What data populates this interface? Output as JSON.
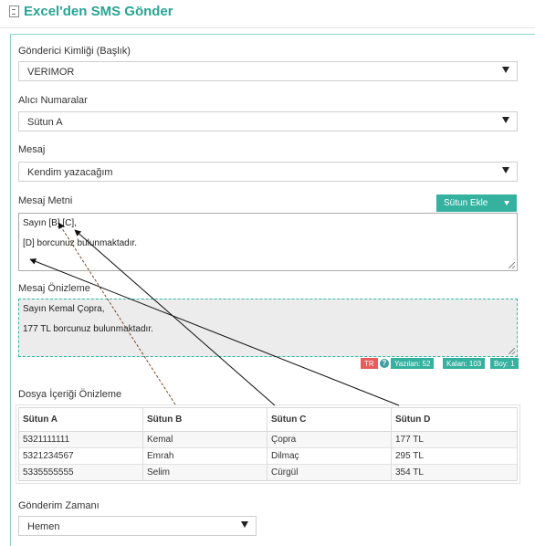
{
  "header": {
    "title": "Excel'den SMS Gönder",
    "icon": "excel-file-icon"
  },
  "sender": {
    "label": "Gönderici Kimliği (Başlık)",
    "value": "VERIMOR"
  },
  "recipients": {
    "label": "Alıcı Numaralar",
    "value": "Sütun A"
  },
  "message": {
    "label": "Mesaj",
    "value": "Kendim yazacağım"
  },
  "message_text": {
    "label": "Mesaj Metni",
    "column_button": "Sütun Ekle",
    "line1": "Sayın [B] [C],",
    "line2": "",
    "line3": "[D] borcunuz bulunmaktadır."
  },
  "message_preview": {
    "label": "Mesaj Önizleme",
    "line1": "Sayın Kemal Çopra,",
    "line2": "",
    "line3": "177 TL borcunuz bulunmaktadır."
  },
  "stats": {
    "lang": "TR",
    "help": "?",
    "written": "Yazılan: 52",
    "remaining": "Kalan: 103",
    "size": "Boy: 1"
  },
  "file_preview": {
    "label": "Dosya İçeriği Önizleme",
    "columns": [
      "Sütun A",
      "Sütun B",
      "Sütun C",
      "Sütun D"
    ],
    "rows": [
      [
        "5321111111",
        "Kemal",
        "Çopra",
        "177 TL"
      ],
      [
        "5321234567",
        "Emrah",
        "Dilmaç",
        "295 TL"
      ],
      [
        "5335555555",
        "Selim",
        "Cürgül",
        "354 TL"
      ]
    ]
  },
  "schedule": {
    "label": "Gönderim Zamanı",
    "value": "Hemen"
  },
  "colors": {
    "accent": "#35b1a0",
    "title": "#27a595",
    "danger": "#e85b5b"
  }
}
